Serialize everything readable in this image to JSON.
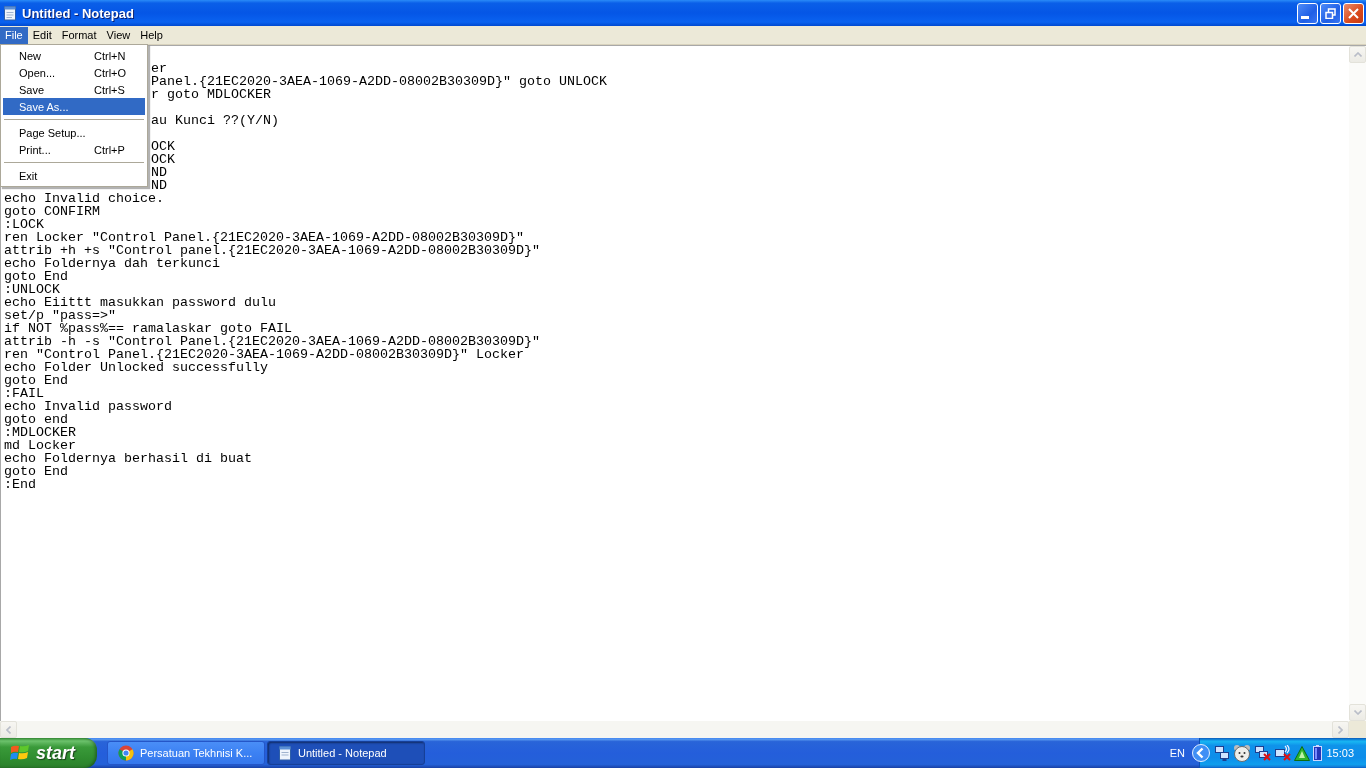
{
  "window": {
    "title": "Untitled - Notepad"
  },
  "menu_bar": [
    {
      "label": "File",
      "selected": true
    },
    {
      "label": "Edit",
      "selected": false
    },
    {
      "label": "Format",
      "selected": false
    },
    {
      "label": "View",
      "selected": false
    },
    {
      "label": "Help",
      "selected": false
    }
  ],
  "file_menu": [
    {
      "kind": "item",
      "label": "New",
      "shortcut": "Ctrl+N",
      "selected": false
    },
    {
      "kind": "item",
      "label": "Open...",
      "shortcut": "Ctrl+O",
      "selected": false
    },
    {
      "kind": "item",
      "label": "Save",
      "shortcut": "Ctrl+S",
      "selected": false
    },
    {
      "kind": "item",
      "label": "Save As...",
      "selected": true
    },
    {
      "kind": "separator"
    },
    {
      "kind": "item",
      "label": "Page Setup...",
      "selected": false
    },
    {
      "kind": "item",
      "label": "Print...",
      "shortcut": "Ctrl+P",
      "selected": false
    },
    {
      "kind": "separator"
    },
    {
      "kind": "item",
      "label": "Exit",
      "selected": false
    }
  ],
  "editor": {
    "line_groups_beside_menu": [
      [
        "er",
        "Panel.{21EC2020-3AEA-1069-A2DD-08002B30309D}\" goto UNLOCK",
        "r goto MDLOCKER"
      ],
      [
        "au Kunci ??(Y/N)"
      ],
      [
        "OCK",
        "OCK",
        "ND",
        "ND"
      ]
    ],
    "lines": [
      "echo Invalid choice.",
      "goto CONFIRM",
      ":LOCK",
      "ren Locker \"Control Panel.{21EC2020-3AEA-1069-A2DD-08002B30309D}\"",
      "attrib +h +s \"Control panel.{21EC2020-3AEA-1069-A2DD-08002B30309D}\"",
      "echo Foldernya dah terkunci",
      "goto End",
      ":UNLOCK",
      "echo Eiittt masukkan password dulu",
      "set/p \"pass=>\"",
      "if NOT %pass%== ramalaskar goto FAIL",
      "attrib -h -s \"Control Panel.{21EC2020-3AEA-1069-A2DD-08002B30309D}\"",
      "ren \"Control Panel.{21EC2020-3AEA-1069-A2DD-08002B30309D}\" Locker",
      "echo Folder Unlocked successfully",
      "goto End",
      ":FAIL",
      "echo Invalid password",
      "goto end",
      ":MDLOCKER",
      "md Locker",
      "echo Foldernya berhasil di buat",
      "goto End",
      ":End"
    ]
  },
  "taskbar": {
    "start": "start",
    "tasks": [
      {
        "kind": "browser",
        "label": "Persatuan Tekhnisi K...",
        "selected": false
      },
      {
        "kind": "notepad",
        "label": "Untitled - Notepad",
        "selected": true
      }
    ],
    "language": "EN",
    "clock": "15:03"
  }
}
